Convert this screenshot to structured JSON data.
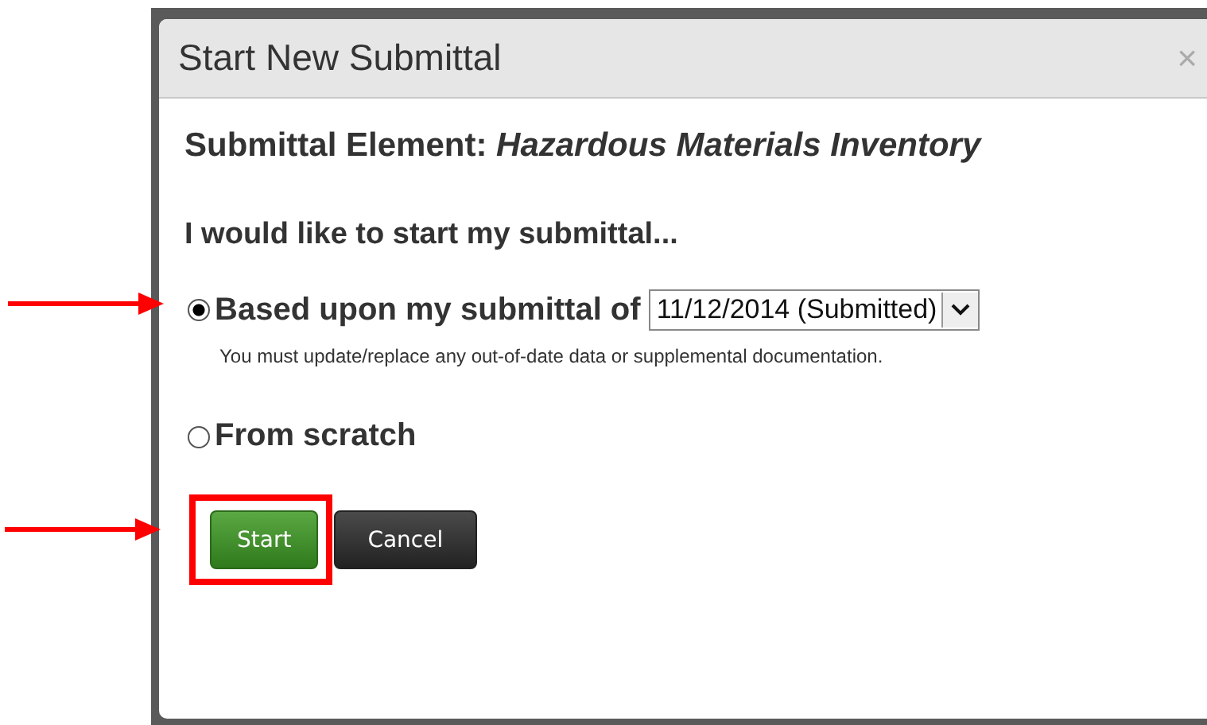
{
  "dialog": {
    "title": "Start New Submittal",
    "close": "×",
    "heading_label": "Submittal Element:",
    "heading_value": "Hazardous Materials Inventory",
    "prompt": "I would like to start my submittal...",
    "options": [
      {
        "label": "Based upon my submittal of",
        "selected": true,
        "kind": "dropdown",
        "value": "11/12/2014 (Submitted)",
        "note": "You must update/replace any out-of-date data or supplemental documentation.",
        "arrow": true
      },
      {
        "label": "From scratch",
        "selected": false,
        "kind": "plain",
        "arrow": false
      }
    ],
    "buttons": [
      {
        "label": "Start",
        "kind": "primary",
        "highlighted": true,
        "arrow": true
      },
      {
        "label": "Cancel",
        "kind": "secondary",
        "highlighted": false,
        "arrow": false
      }
    ]
  }
}
